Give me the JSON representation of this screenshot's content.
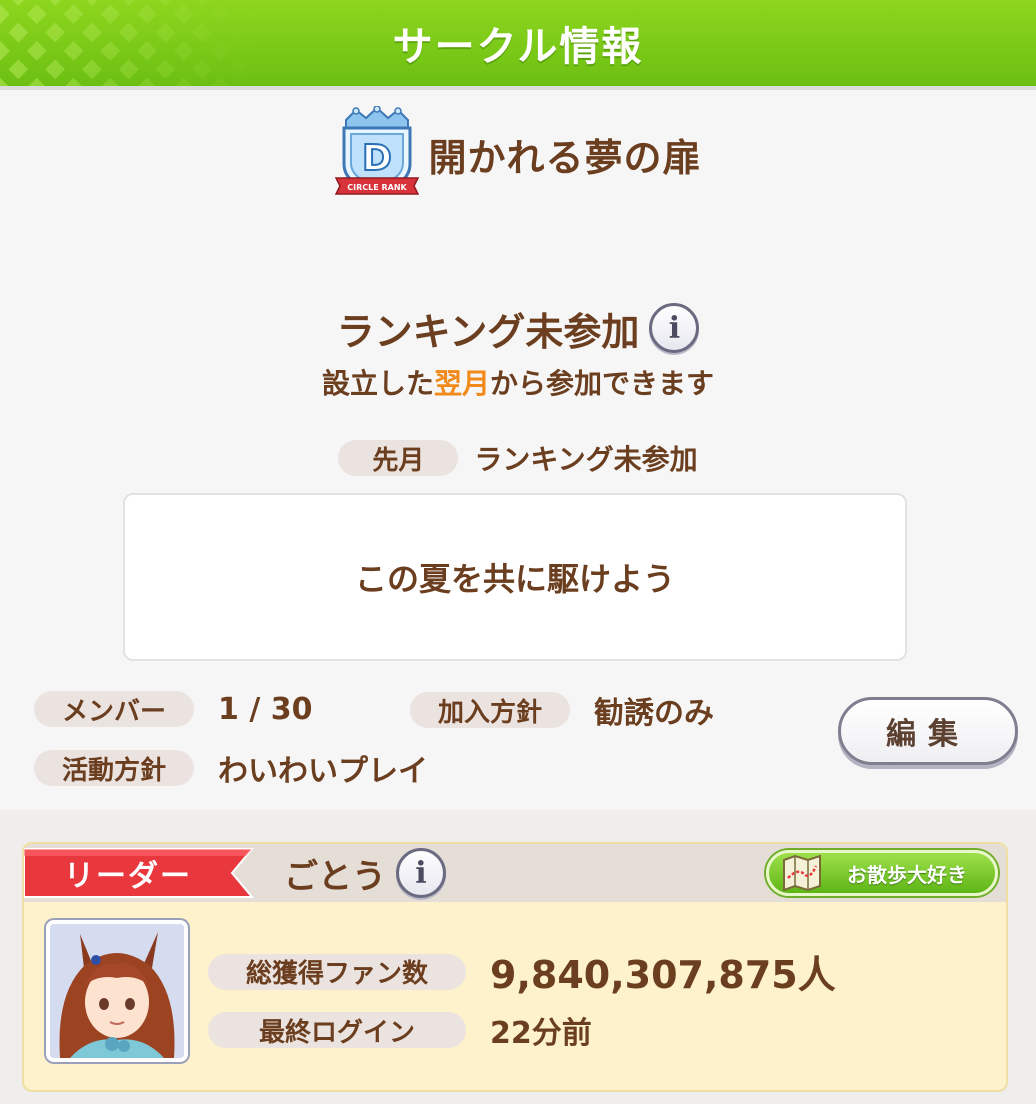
{
  "header": {
    "title": "サークル情報"
  },
  "circle": {
    "rank_letter": "D",
    "rank_caption": "CIRCLE RANK",
    "name": "開かれる夢の扉"
  },
  "ranking": {
    "status": "ランキング未参加",
    "info_glyph": "i",
    "note_before": "設立した",
    "note_highlight": "翌月",
    "note_after": "から参加できます",
    "last_month_label": "先月",
    "last_month_value": "ランキング未参加"
  },
  "message": "この夏を共に駆けよう",
  "stats": {
    "members_label": "メンバー",
    "members_value": "1 / 30",
    "join_policy_label": "加入方針",
    "join_policy_value": "勧誘のみ",
    "activity_label": "活動方針",
    "activity_value": "わいわいプレイ"
  },
  "edit_button": "編集",
  "leader": {
    "ribbon_label": "リーダー",
    "name": "ごとう",
    "info_glyph": "i",
    "title_badge": "お散歩大好き",
    "fans_label": "総獲得ファン数",
    "fans_value": "9,840,307,875人",
    "login_label": "最終ログイン",
    "login_value": "22分前"
  },
  "colors": {
    "header_green": "#7ccb18",
    "text_brown": "#6b3e1f",
    "highlight_orange": "#f18a1b",
    "ribbon_red": "#e8383d",
    "card_yellow": "#fdf2cc"
  }
}
